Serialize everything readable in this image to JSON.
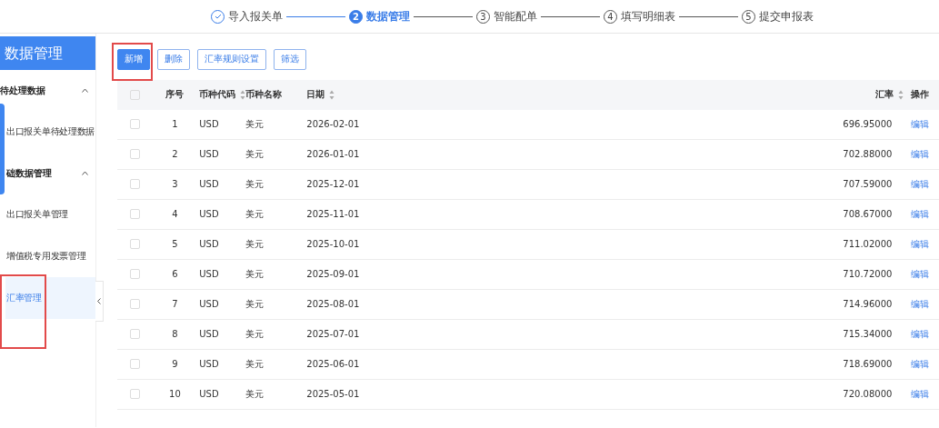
{
  "steps": [
    {
      "label": "导入报关单",
      "done": true,
      "selected": false
    },
    {
      "number": "2",
      "label": "数据管理",
      "done": false,
      "selected": true
    },
    {
      "number": "3",
      "label": "智能配单",
      "done": false,
      "selected": false
    },
    {
      "number": "4",
      "label": "填写明细表",
      "done": false,
      "selected": false
    },
    {
      "number": "5",
      "label": "提交申报表",
      "done": false,
      "selected": false
    }
  ],
  "sidebar": {
    "title": "数据管理",
    "groups": [
      {
        "label": "待处理数据",
        "expanded": true,
        "items": [
          {
            "label": "出口报关单待处理数据",
            "selected": false
          }
        ]
      },
      {
        "label": "础数据管理",
        "expanded": true,
        "items": [
          {
            "label": "出口报关单管理",
            "selected": false
          },
          {
            "label": "增值税专用发票管理",
            "selected": false
          },
          {
            "label": "汇率管理",
            "selected": true,
            "annotated": true
          }
        ]
      }
    ]
  },
  "toolbar": [
    {
      "label": "新增",
      "kind": "primary",
      "annotated": true
    },
    {
      "label": "删除",
      "kind": "default"
    },
    {
      "label": "汇率规则设置",
      "kind": "default"
    },
    {
      "label": "筛选",
      "kind": "default"
    }
  ],
  "table": {
    "all_checked": false,
    "columns": [
      {
        "label": "序号"
      },
      {
        "label": "币种代码",
        "sortable": true
      },
      {
        "label": "币种名称"
      },
      {
        "label": "日期",
        "sortable": true
      },
      {
        "label": "汇率",
        "sortable": true
      },
      {
        "label": "操作"
      }
    ],
    "rows": [
      {
        "cells": [
          "1",
          "USD",
          "美元",
          "2026-02-01",
          "696.95000"
        ],
        "action": "编辑",
        "checked": false
      },
      {
        "cells": [
          "2",
          "USD",
          "美元",
          "2026-01-01",
          "702.88000"
        ],
        "action": "编辑",
        "checked": false
      },
      {
        "cells": [
          "3",
          "USD",
          "美元",
          "2025-12-01",
          "707.59000"
        ],
        "action": "编辑",
        "checked": false
      },
      {
        "cells": [
          "4",
          "USD",
          "美元",
          "2025-11-01",
          "708.67000"
        ],
        "action": "编辑",
        "checked": false
      },
      {
        "cells": [
          "5",
          "USD",
          "美元",
          "2025-10-01",
          "711.02000"
        ],
        "action": "编辑",
        "checked": false
      },
      {
        "cells": [
          "6",
          "USD",
          "美元",
          "2025-09-01",
          "710.72000"
        ],
        "action": "编辑",
        "checked": false
      },
      {
        "cells": [
          "7",
          "USD",
          "美元",
          "2025-08-01",
          "714.96000"
        ],
        "action": "编辑",
        "checked": false
      },
      {
        "cells": [
          "8",
          "USD",
          "美元",
          "2025-07-01",
          "715.34000"
        ],
        "action": "编辑",
        "checked": false
      },
      {
        "cells": [
          "9",
          "USD",
          "美元",
          "2025-06-01",
          "718.69000"
        ],
        "action": "编辑",
        "checked": false
      },
      {
        "cells": [
          "10",
          "USD",
          "美元",
          "2025-05-01",
          "720.08000"
        ],
        "action": "编辑",
        "checked": false
      }
    ]
  }
}
